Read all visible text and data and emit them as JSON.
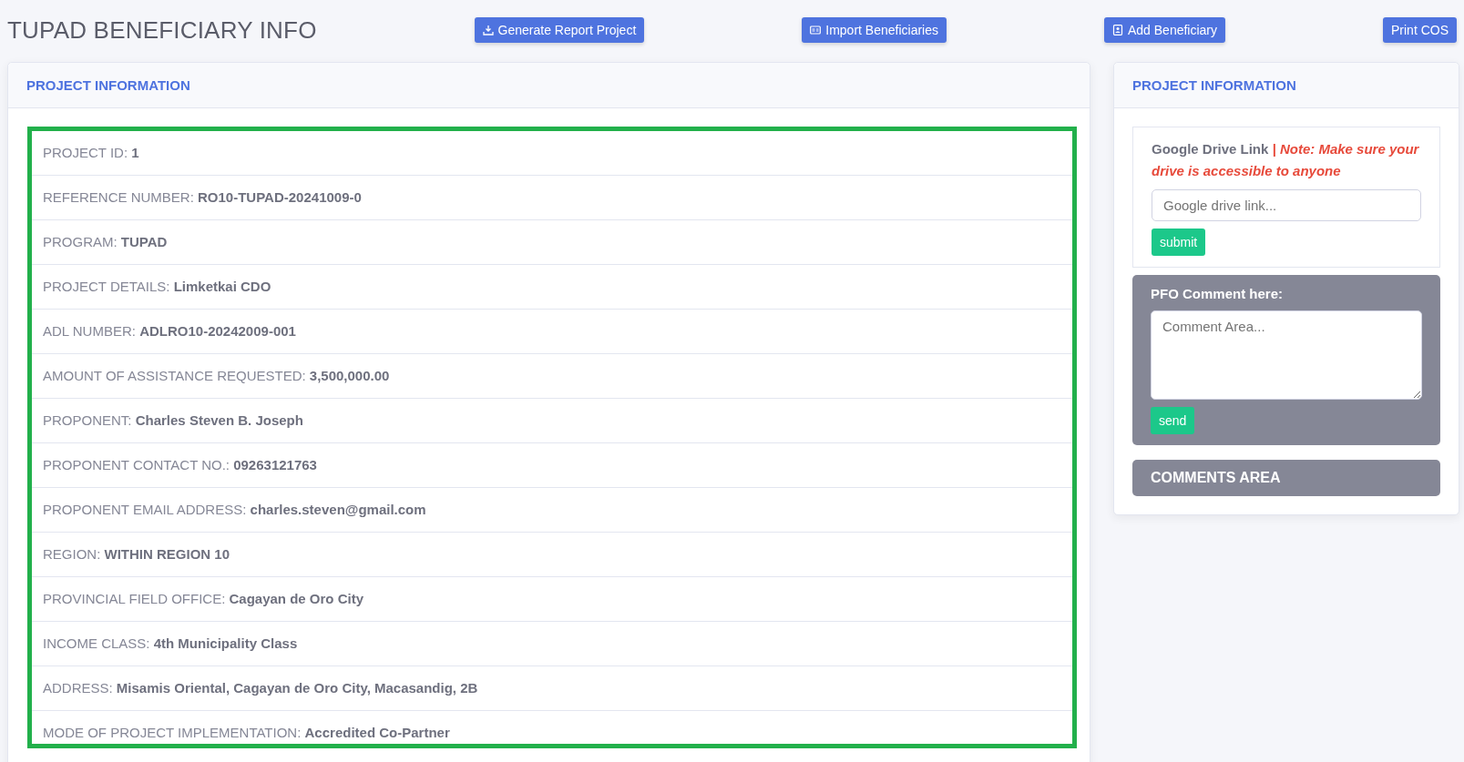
{
  "page_title": "TUPAD BENEFICIARY INFO",
  "toolbar": [
    {
      "label": "Generate Report Project"
    },
    {
      "label": "Import Beneficiaries"
    },
    {
      "label": "Add Beneficiary"
    },
    {
      "label": "Print COS"
    }
  ],
  "project_card": {
    "title": "PROJECT INFORMATION",
    "rows": [
      "PROJECT ID: **1**",
      "REFERENCE NUMBER: **RO10-TUPAD-20241009-0**",
      "PROGRAM: **TUPAD**",
      "PROJECT DETAILS: **Limketkai CDO**",
      "ADL NUMBER: **ADLRO10-20242009-001**",
      "AMOUNT OF ASSISTANCE REQUESTED: **3,500,000.00**",
      "PROPONENT: **Charles Steven B. Joseph**",
      "PROPONENT CONTACT NO.: **09263121763**",
      "PROPONENT EMAIL ADDRESS: **charles.steven@gmail.com**",
      "REGION: **WITHIN REGION 10**",
      "PROVINCIAL FIELD OFFICE: **Cagayan de Oro City**",
      "INCOME CLASS: **4th Municipality Class**",
      "ADDRESS: **Misamis Oriental, Cagayan de Oro City, Macasandig, 2B**",
      "MODE OF PROJECT IMPLEMENTATION: **Accredited Co-Partner**"
    ]
  },
  "side_card": {
    "title": "PROJECT INFORMATION",
    "drive": {
      "label": "Google Drive Link *| Note: Make sure your drive is accessible to anyone*",
      "placeholder": "Google drive link...",
      "button": "submit"
    },
    "comment": {
      "label": "PFO Comment here:",
      "placeholder": "Comment Area...",
      "button": "send"
    },
    "comments_area": "COMMENTS AREA"
  }
}
